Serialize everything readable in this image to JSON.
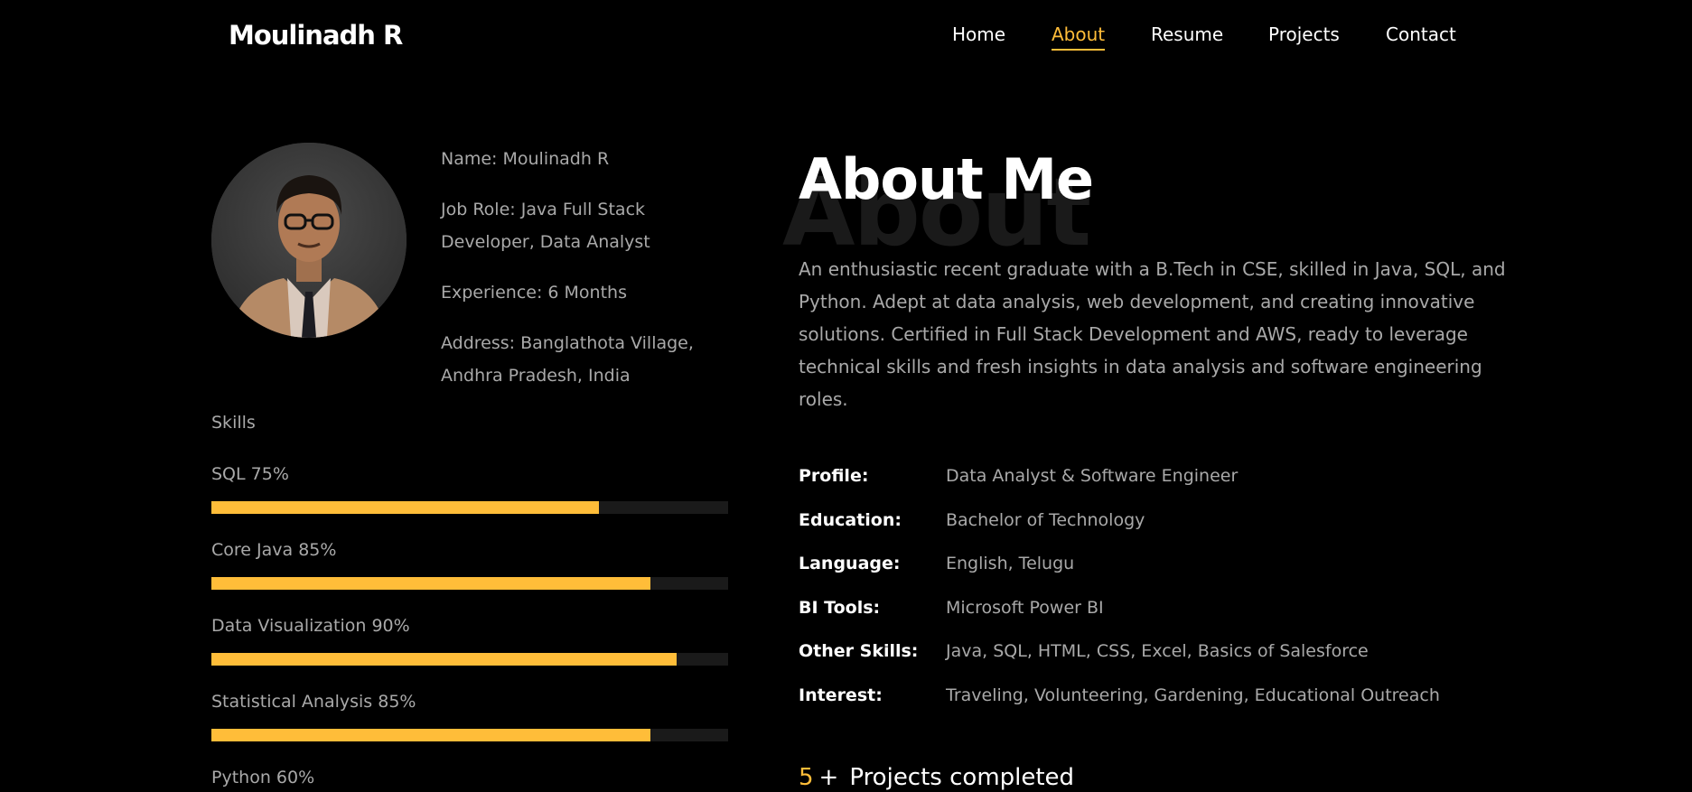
{
  "header": {
    "brand": "Moulinadh R",
    "nav": {
      "home": "Home",
      "about": "About",
      "resume": "Resume",
      "projects": "Projects",
      "contact": "Contact"
    },
    "active_item": "About"
  },
  "profile": {
    "avatar_icon": "profile-photo",
    "name_line": "Name: Moulinadh R",
    "role_line": "Job Role: Java Full Stack Developer, Data Analyst",
    "experience_line": "Experience: 6 Months",
    "address_line": "Address: Banglathota Village, Andhra Pradesh, India"
  },
  "skills": {
    "title": "Skills",
    "items": [
      {
        "label": "SQL 75%",
        "percent": 75
      },
      {
        "label": "Core Java 85%",
        "percent": 85
      },
      {
        "label": "Data Visualization 90%",
        "percent": 90
      },
      {
        "label": "Statistical Analysis 85%",
        "percent": 85
      },
      {
        "label": "Python 60%",
        "percent": 60
      }
    ]
  },
  "about": {
    "bg_word": "About",
    "heading": "About Me",
    "description": "An enthusiastic recent graduate with a B.Tech in CSE, skilled in Java, SQL, and Python. Adept at data analysis, web development, and creating innovative solutions. Certified in Full Stack Development and AWS, ready to leverage technical skills and fresh insights in data analysis and software engineering roles.",
    "details": [
      {
        "key": "Profile:",
        "value": "Data Analyst & Software Engineer"
      },
      {
        "key": "Education:",
        "value": "Bachelor of Technology"
      },
      {
        "key": "Language:",
        "value": "English, Telugu"
      },
      {
        "key": "BI Tools:",
        "value": "Microsoft Power BI"
      },
      {
        "key": "Other Skills:",
        "value": "Java, SQL, HTML, CSS, Excel, Basics of Salesforce"
      },
      {
        "key": "Interest:",
        "value": "Traveling, Volunteering, Gardening, Educational Outreach"
      }
    ],
    "projects": {
      "count": "5",
      "plus": "+",
      "label": "Projects completed"
    }
  },
  "colors": {
    "accent": "#ffbd39",
    "background": "#000000",
    "muted_text": "#a9a9a9",
    "track": "#1a1a1a"
  }
}
